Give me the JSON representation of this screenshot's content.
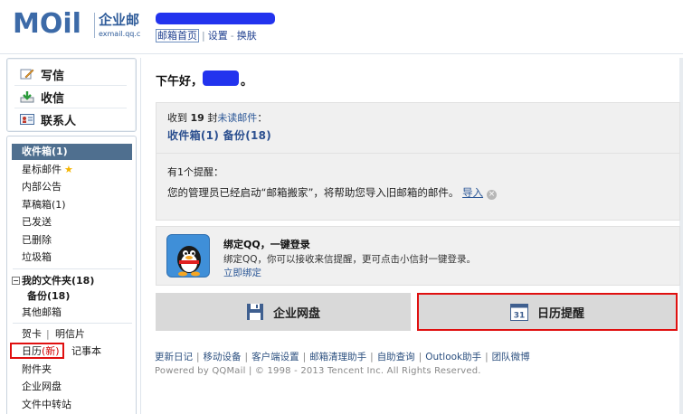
{
  "header": {
    "logo_text": "MOil",
    "logo_cn": "企业邮",
    "logo_url": "exmail.qq.c",
    "links": [
      "邮箱首页",
      "设置",
      "换肤"
    ]
  },
  "sidebar": {
    "actions": {
      "write": "写信",
      "inbox": "收信",
      "contacts": "联系人"
    },
    "nav": {
      "inbox": "收件箱(1)",
      "starred": "星标邮件",
      "internal": "内部公告",
      "drafts": "草稿箱(1)",
      "sent": "已发送",
      "deleted": "已删除",
      "spam": "垃圾箱",
      "my_folders": "我的文件夹(18)",
      "backup": "备份(18)",
      "other": "其他邮箱",
      "greeting_card": "贺卡",
      "postcard": "明信片",
      "calendar": "日历",
      "calendar_new": "(新)",
      "notes": "记事本",
      "attachments": "附件夹",
      "netdisk": "企业网盘",
      "transfer": "文件中转站"
    }
  },
  "main": {
    "greeting": "下午好，",
    "greeting_end": "。",
    "received_prefix": "收到",
    "received_count": "19",
    "received_middle": "封",
    "received_link": "未读邮件",
    "received_suffix": "：",
    "folder_counts": "收件箱(1)  备份(18)",
    "reminder_count": "有1个提醒：",
    "reminder_text": "您的管理员已经启动“邮箱搬家”，将帮助您导入旧邮箱的邮件。",
    "reminder_link": "导入",
    "qq_title": "绑定QQ，一键登录",
    "qq_desc": "绑定QQ，你可以接收来信提醒，更可点击小信封一键登录。",
    "qq_bind": "立即绑定",
    "btn_netdisk": "企业网盘",
    "btn_calendar": "日历提醒",
    "calendar_icon_num": "31",
    "footer_links": [
      "更新日记",
      "移动设备",
      "客户端设置",
      "邮箱清理助手",
      "自助查询",
      "Outlook助手",
      "团队微博"
    ],
    "copyright": "Powered by QQMail | © 1998 - 2013 Tencent Inc. All Rights Reserved."
  },
  "colors": {
    "brand_blue": "#3c6aa8",
    "selected_nav": "#4f6f8f",
    "highlight_red": "#e01010",
    "panel_gray": "#f0f0f0"
  }
}
